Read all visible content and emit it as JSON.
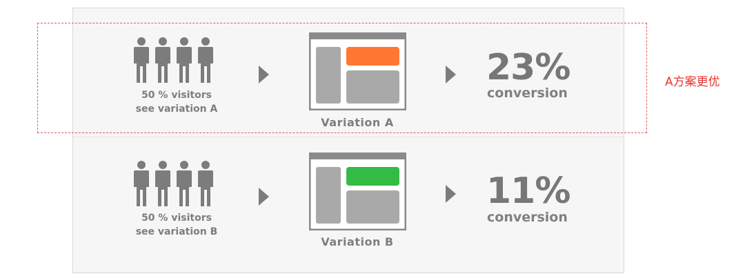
{
  "rows": [
    {
      "visitors_line1": "50 % visitors",
      "visitors_line2": "see variation A",
      "variation_label": "Variation A",
      "percent": "23%",
      "conversion_label": "conversion",
      "accent_color": "#ff7733"
    },
    {
      "visitors_line1": "50 % visitors",
      "visitors_line2": "see variation B",
      "variation_label": "Variation B",
      "percent": "11%",
      "conversion_label": "conversion",
      "accent_color": "#33bb44"
    }
  ],
  "annotation": {
    "text": "A方案更优",
    "color": "#e8332b"
  },
  "icons": {
    "people": "people-group-icon",
    "arrow": "arrow-right-icon",
    "mockup": "webpage-mockup-icon"
  }
}
